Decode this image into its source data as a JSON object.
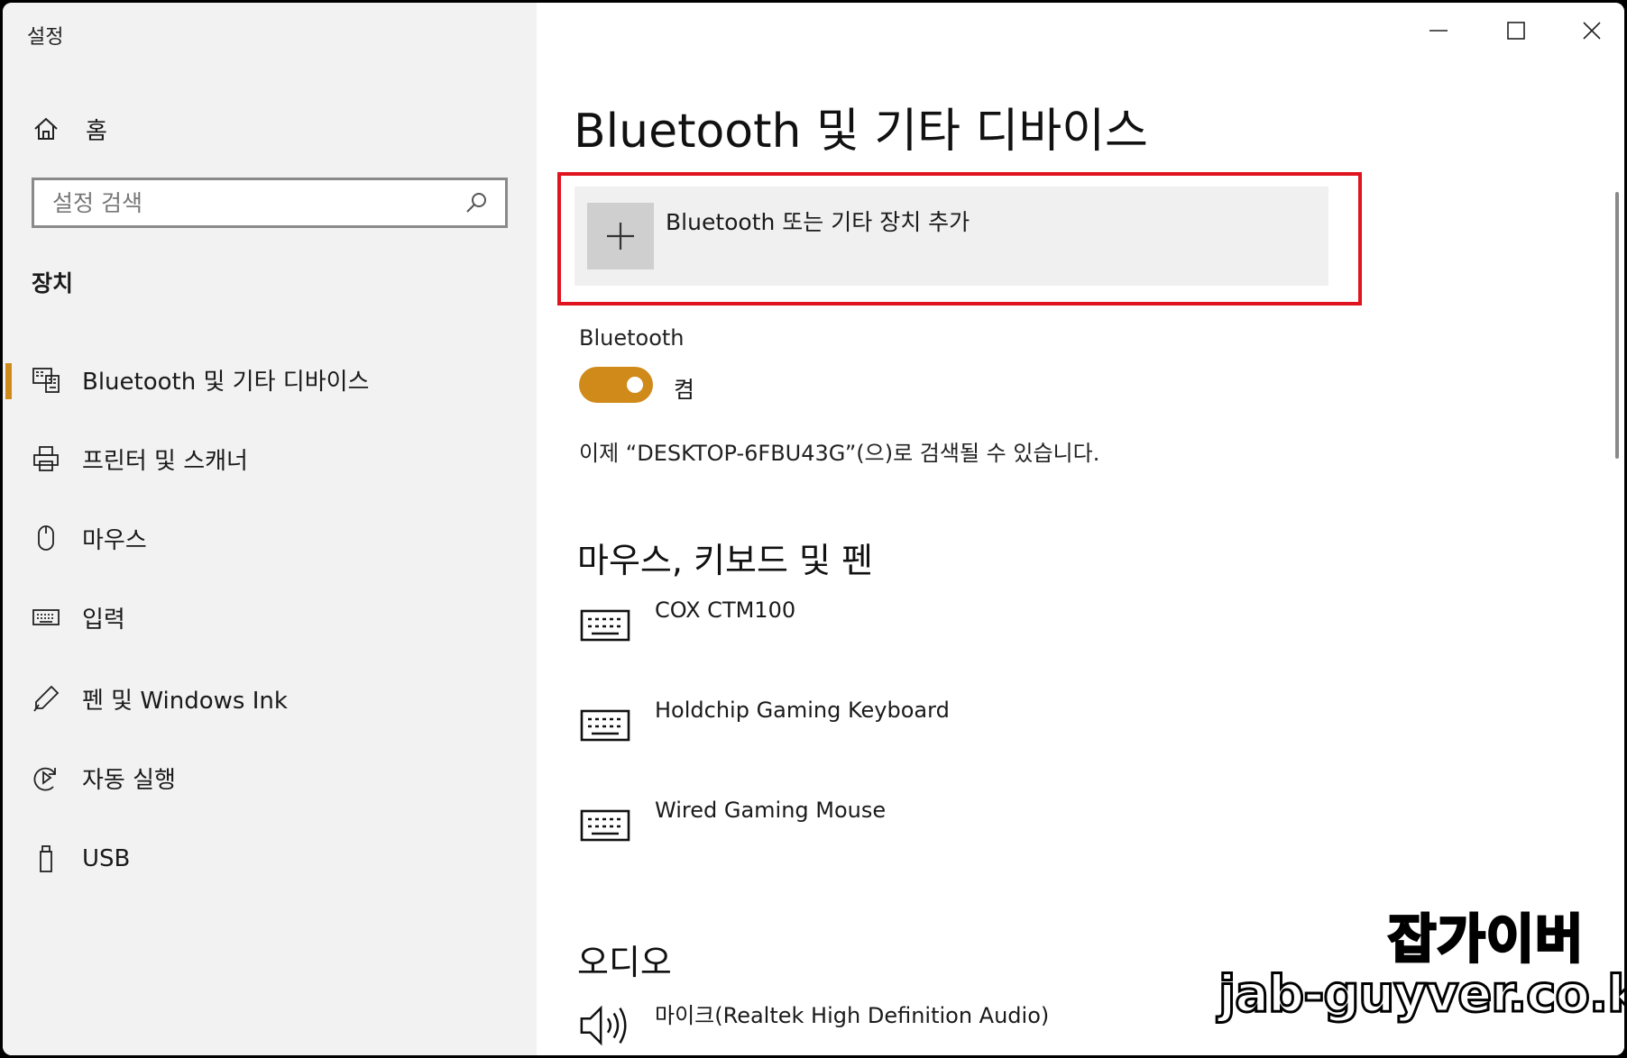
{
  "window": {
    "app_title": "설정",
    "controls": {
      "minimize": "minimize-icon",
      "maximize": "maximize-icon",
      "close": "close-icon"
    }
  },
  "sidebar": {
    "home_label": "홈",
    "search_placeholder": "설정 검색",
    "section_title": "장치",
    "items": [
      {
        "label": "Bluetooth 및 기타 디바이스",
        "icon": "bluetooth-devices-icon",
        "selected": true
      },
      {
        "label": "프린터 및 스캐너",
        "icon": "printer-icon",
        "selected": false
      },
      {
        "label": "마우스",
        "icon": "mouse-icon",
        "selected": false
      },
      {
        "label": "입력",
        "icon": "keyboard-icon",
        "selected": false
      },
      {
        "label": "펜 및 Windows Ink",
        "icon": "pen-icon",
        "selected": false
      },
      {
        "label": "자동 실행",
        "icon": "autoplay-icon",
        "selected": false
      },
      {
        "label": "USB",
        "icon": "usb-icon",
        "selected": false
      }
    ],
    "accent_color": "#d08a1a"
  },
  "main": {
    "title": "Bluetooth 및 기타 디바이스",
    "add_device_label": "Bluetooth 또는 기타 장치 추가",
    "bluetooth": {
      "label": "Bluetooth",
      "toggle_state": "켬",
      "on": true,
      "discoverable_text": "이제 “DESKTOP-6FBU43G”(으)로 검색될 수 있습니다."
    },
    "sections": [
      {
        "title": "마우스, 키보드 및 펜",
        "devices": [
          {
            "name": "COX CTM100",
            "icon": "keyboard-icon"
          },
          {
            "name": "Holdchip Gaming Keyboard",
            "icon": "keyboard-icon"
          },
          {
            "name": "Wired Gaming Mouse",
            "icon": "keyboard-icon"
          }
        ]
      },
      {
        "title": "오디오",
        "devices": [
          {
            "name": "마이크(Realtek High Definition Audio)",
            "icon": "speaker-icon"
          }
        ]
      }
    ]
  },
  "highlight_color": "#e0141e",
  "watermark": {
    "line1": "잡가이버",
    "line2": "jab-guyver.co.kr"
  }
}
